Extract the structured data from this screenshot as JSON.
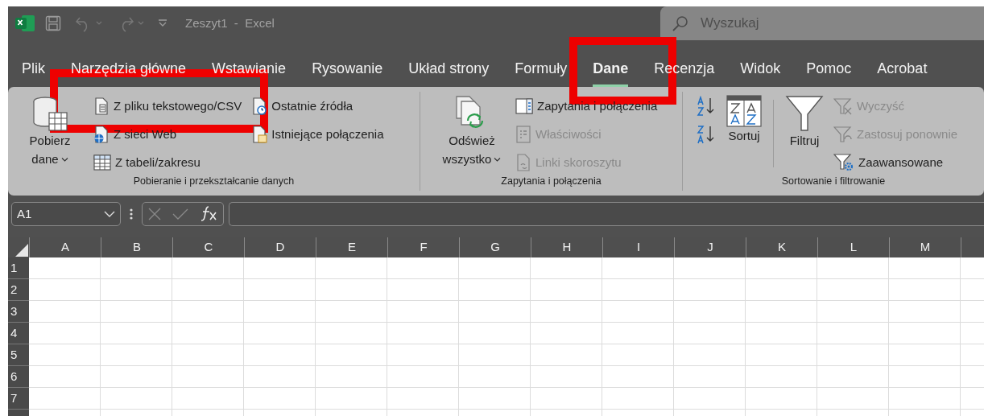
{
  "title_bar": {
    "title": "Zeszyt1  -  Excel"
  },
  "search": {
    "placeholder": "Wyszukaj"
  },
  "tabs": [
    {
      "label": "Plik",
      "selected": false
    },
    {
      "label": "Narzędzia główne",
      "selected": false
    },
    {
      "label": "Wstawianie",
      "selected": false
    },
    {
      "label": "Rysowanie",
      "selected": false
    },
    {
      "label": "Układ strony",
      "selected": false
    },
    {
      "label": "Formuły",
      "selected": false
    },
    {
      "label": "Dane",
      "selected": true
    },
    {
      "label": "Recenzja",
      "selected": false
    },
    {
      "label": "Widok",
      "selected": false
    },
    {
      "label": "Pomoc",
      "selected": false
    },
    {
      "label": "Acrobat",
      "selected": false
    }
  ],
  "ribbon_groups": [
    {
      "label": "Pobieranie i przekształcanie danych",
      "columns": [
        [
          {
            "kind": "large",
            "label": "Pobierz dane",
            "dropdown": true,
            "disabled": false
          }
        ],
        [
          {
            "kind": "small",
            "label": "Z pliku tekstowego/CSV",
            "disabled": false
          },
          {
            "kind": "small",
            "label": "Z sieci Web",
            "disabled": false
          },
          {
            "kind": "small",
            "label": "Z tabeli/zakresu",
            "disabled": false
          }
        ],
        [
          {
            "kind": "small",
            "label": "Ostatnie źródła",
            "disabled": false
          },
          {
            "kind": "small",
            "label": "Istniejące połączenia",
            "disabled": false
          }
        ]
      ]
    },
    {
      "label": "Zapytania i połączenia",
      "columns": [
        [
          {
            "kind": "large",
            "label": "Odśwież wszystko",
            "dropdown": true,
            "disabled": false
          }
        ],
        [
          {
            "kind": "small",
            "label": "Zapytania i połączenia",
            "disabled": false
          },
          {
            "kind": "small",
            "label": "Właściwości",
            "disabled": true
          },
          {
            "kind": "small",
            "label": "Linki skoroszytu",
            "disabled": true
          }
        ]
      ]
    },
    {
      "label": "Sortowanie i filtrowanie",
      "columns": [
        [
          {
            "kind": "icon",
            "disabled": false
          },
          {
            "kind": "icon",
            "disabled": false
          }
        ],
        [
          {
            "kind": "large",
            "label": "Sortuj",
            "dropdown": false,
            "disabled": false
          }
        ],
        [
          {
            "kind": "separator"
          }
        ],
        [
          {
            "kind": "large",
            "label": "Filtruj",
            "dropdown": false,
            "disabled": false
          }
        ],
        [
          {
            "kind": "small",
            "label": "Wyczyść",
            "disabled": true
          },
          {
            "kind": "small",
            "label": "Zastosuj ponownie",
            "disabled": true
          },
          {
            "kind": "small",
            "label": "Zaawansowane",
            "disabled": false
          }
        ]
      ]
    }
  ],
  "formula_bar": {
    "name_box": "A1"
  },
  "sheet": {
    "columns": [
      "A",
      "B",
      "C",
      "D",
      "E",
      "F",
      "G",
      "H",
      "I",
      "J",
      "K",
      "L",
      "M"
    ],
    "rows": [
      "1",
      "2",
      "3",
      "4",
      "5",
      "6",
      "7"
    ]
  },
  "annotations": [
    {
      "kind": "frame"
    },
    {
      "kind": "frame"
    }
  ]
}
